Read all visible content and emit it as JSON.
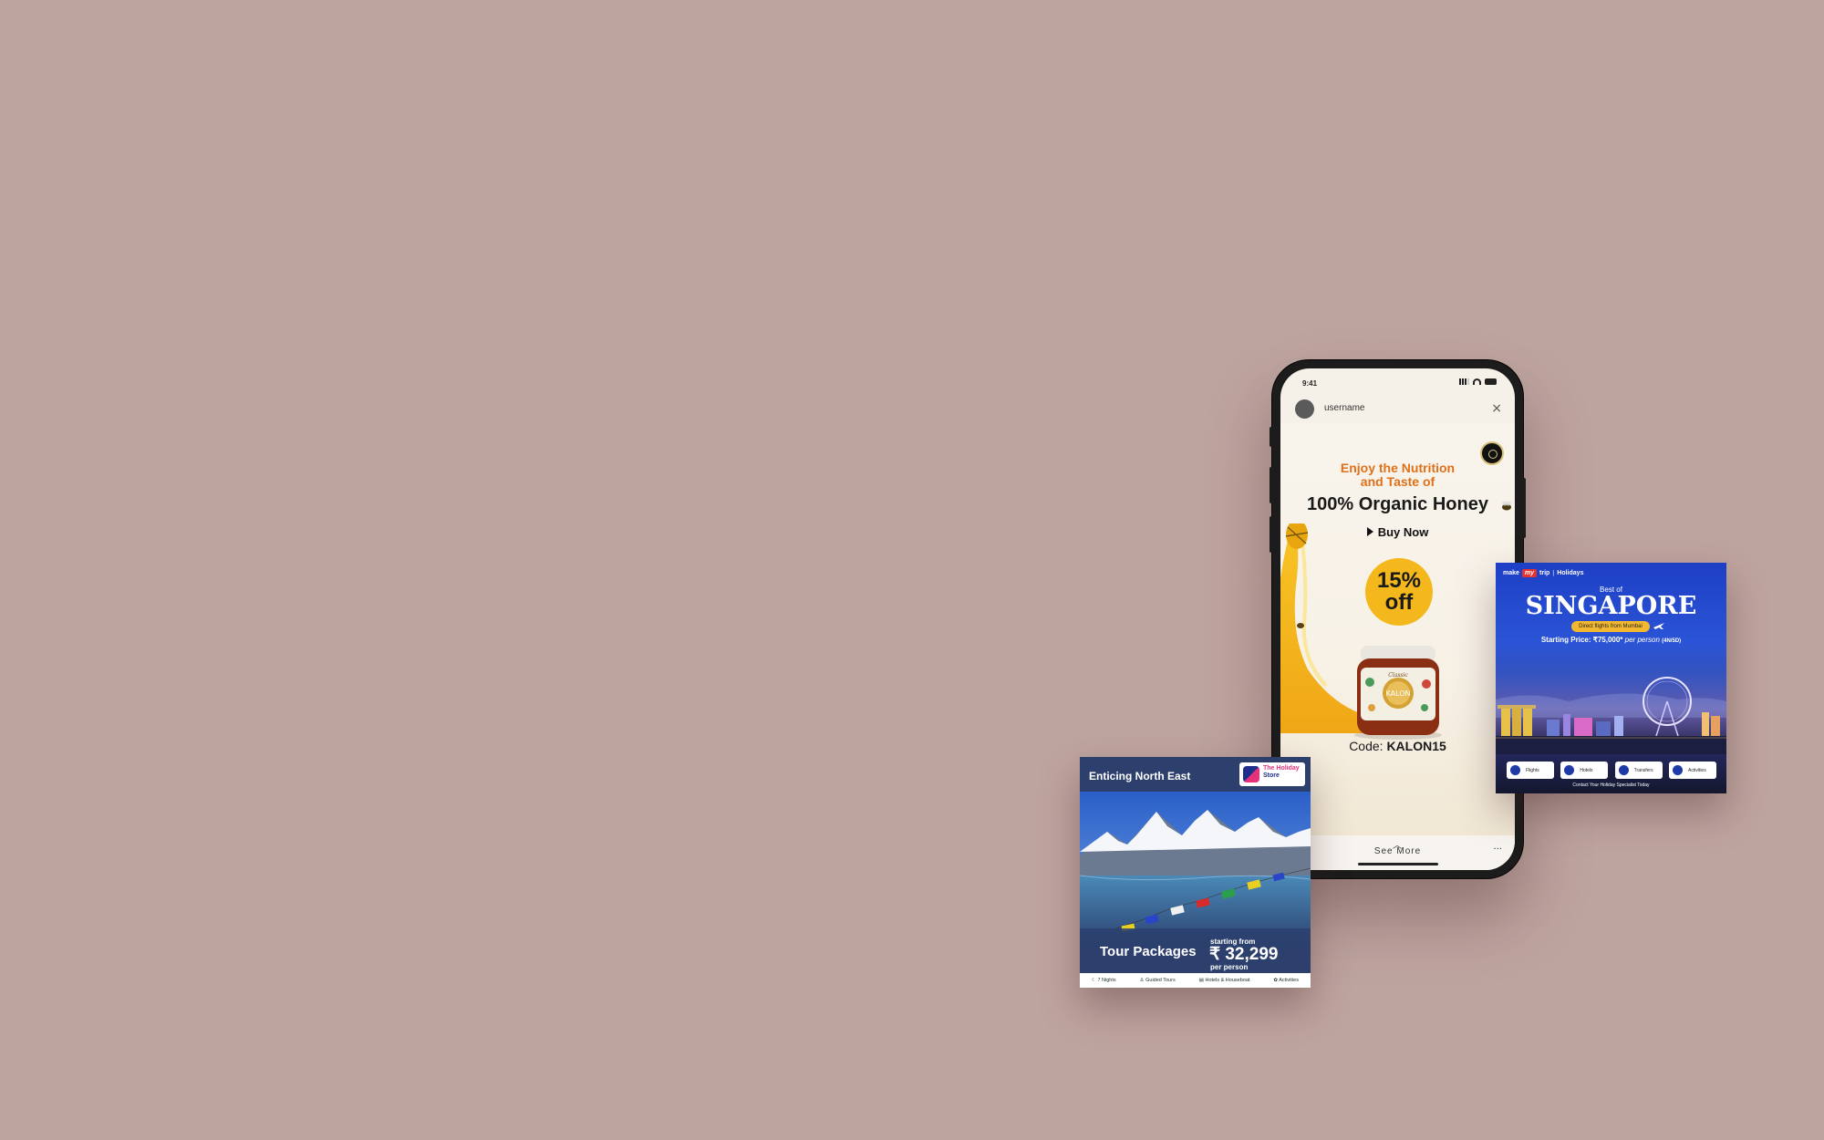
{
  "phone": {
    "status_time": "9:41",
    "username": "username",
    "close_glyph": "×",
    "ad": {
      "headline_line1": "Enjoy the Nutrition",
      "headline_line2": "and Taste of",
      "headline_main": "100% Organic Honey",
      "cta": "Buy Now",
      "discount_line1": "15%",
      "discount_line2": "off",
      "code_label": "Code:",
      "code_value": "KALON15",
      "jar_brand": "KALON",
      "jar_script": "Classic"
    },
    "see_more": "See More",
    "more_glyph": "···"
  },
  "singapore_card": {
    "brand_make": "make",
    "brand_my": "my",
    "brand_trip": "trip",
    "brand_holidays": "Holidays",
    "best_of": "Best of",
    "title": "SINGAPORE",
    "pill": "Direct flights from Mumbai",
    "price_prefix": "Starting Price:",
    "price_value": "₹75,000*",
    "price_suffix": "per person",
    "price_duration": "(4N/5D)",
    "tiles": [
      "Flights",
      "Hotels",
      "Transfers",
      "Activities"
    ],
    "contact": "Contact Your Holiday Specialist Today"
  },
  "northeast_card": {
    "title": "Enticing North East",
    "logo_line1": "The Holiday",
    "logo_line2": "Store",
    "tour_label": "Tour Packages",
    "starting_from": "starting from",
    "price": "₹ 32,299",
    "per_person": "per person",
    "features": [
      "7 Nights",
      "Guided Tours",
      "Hotels & Houseboat",
      "Activities"
    ]
  }
}
